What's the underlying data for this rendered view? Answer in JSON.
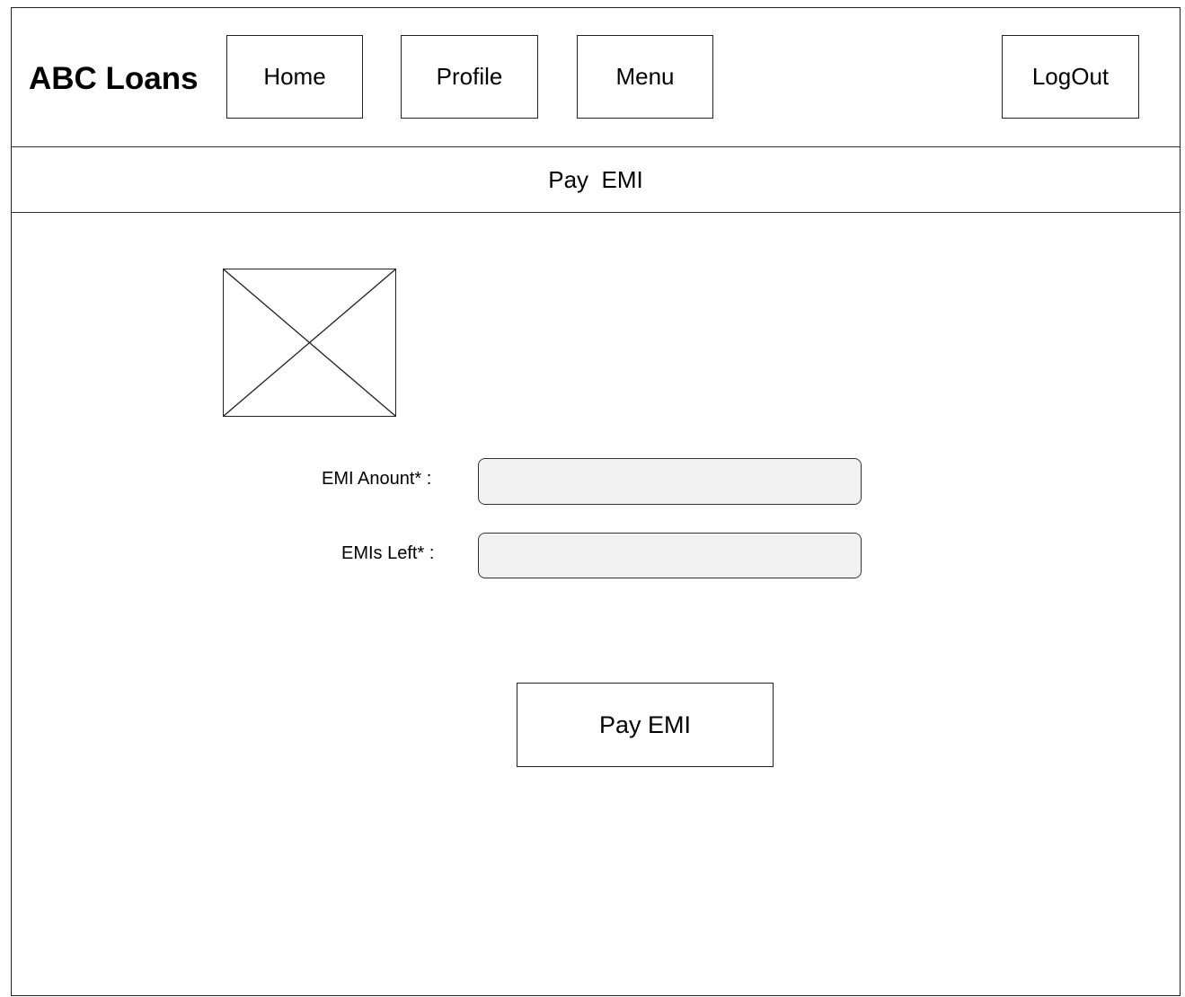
{
  "header": {
    "brand": "ABC Loans",
    "nav": {
      "home": "Home",
      "profile": "Profile",
      "menu": "Menu",
      "logout": "LogOut"
    }
  },
  "page": {
    "title": "Pay  EMI"
  },
  "image": {
    "icon": "image-placeholder-icon"
  },
  "form": {
    "emi_amount_label": "EMI Anount* :",
    "emi_amount_value": "",
    "emis_left_label": "EMIs Left* :",
    "emis_left_value": "",
    "submit_label": "Pay EMI"
  }
}
